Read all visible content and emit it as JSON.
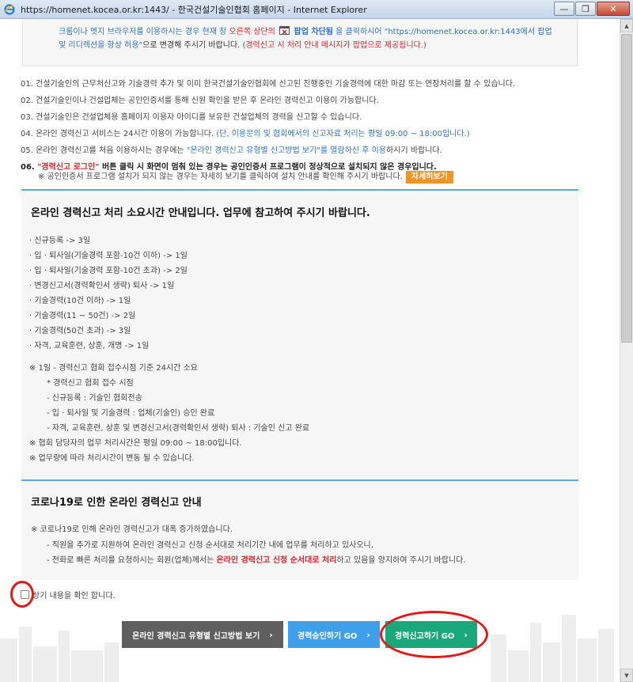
{
  "window": {
    "title": "https://homenet.kocea.or.kr:1443/ - 한국건설기술인협회 홈페이지 - Internet Explorer",
    "buttons": {
      "minimize": "—",
      "restore": "❐",
      "close": "✕"
    }
  },
  "notice": {
    "line1_a": "크롬이나 엣지 브라우저를 이용하시는 경우 현재 창 ",
    "line1_b": "오른쪽 상단의",
    "line1_c": " 팝업 차단됨",
    "line1_d": " 을 클릭하시어 \"https://homenet.kocea.or.kr:1443에서 팝업",
    "line2_a": "및 리디렉션을 항상 허용\"",
    "line2_b": "으로 변경해 주시기 바랍니다. ",
    "line2_c": "(경력신고 시 처리 안내 메시지가 팝업으로 제공됩니다.)"
  },
  "items": [
    "01. 건설기술인의 근무처신고와 기술경력 추가 및 이미 한국건설기술인협회에 신고된 진행중인 기술경력에 대한 마감 또는 연장처리를 할 수 있습니다.",
    "02. 건설기술인이나 건설업체는 공인인증서를 통해 신원 확인을 받은 후 온라인 경력신고 이용이 가능합니다.",
    "03. 건설기술인은 건설업체용 홈페이지 이용자 아이디를 보유한 건설업체의 경력을 신고할 수 있습니다."
  ],
  "item04": {
    "a": "04. 온라인 경력신고 서비스는 24시간 이용이 가능합니다. ",
    "b": "(단, 이용문의 및 협회에서의 신고자료 처리는 평일 09:00 ~ 18:00입니다.)"
  },
  "item05": {
    "a": "05. 온라인 경력신고를 처음 이용하시는 경우에는 ",
    "b": "\"온라인 경력신고 유형별 신고방법 보기\"를 열람하신 후 이용",
    "c": "하시기 바랍니다."
  },
  "item06": {
    "a": "06. ",
    "b": "\"경력신고 로그인\"",
    "c": " 버튼 클릭 시 화면이 멈춰 있는 경우는 공인인증서 프로그램이 정상적으로 설치되지 않은 경우입니다."
  },
  "subnote": {
    "text": "※ 공인인증서 프로그램 설치가 되지 않는 경우는 자세히 보기를 클릭하여 설치 안내를 확인해 주시기 바랍니다.",
    "button": "자세히보기"
  },
  "processing": {
    "title": "온라인 경력신고 처리 소요시간 안내입니다. 업무에 참고하여 주시기 바랍니다.",
    "times": [
      "· 신규등록 -> 3일",
      "· 입 · 퇴사일(기술경력 포함-10건 이하) -> 1일",
      "· 입 · 퇴사일(기술경력 포함-10건 초과) -> 2일",
      "· 변경신고서(경력확인서 생략) 퇴사 -> 1일",
      "· 기술경력(10건 이하) -> 1일",
      "· 기술경력(11 ~ 50건) -> 2일",
      "· 기술경력(50건 초과) -> 3일",
      "· 자격, 교육훈련, 상훈, 개명 -> 1일"
    ],
    "notes": [
      "※ 1일 - 경력신고 협회 접수시점 기준 24시간 소요",
      "* 경력신고 협회 접수 시점",
      "- 신규등록 : 기술인 협회전송",
      "- 입 · 퇴사일 및 기술경력 : 업체(기술인) 승인 완료",
      "- 자격, 교육훈련, 상훈 및 변경신고서(경력확인서 생략) 퇴사 : 기술인 신고 완료",
      "※ 협회 담당자의 업무 처리시간은 평일 09:00 ~ 18:00입니다.",
      "※ 업무량에 따라 처리시간이 변동 될 수 있습니다."
    ]
  },
  "corona": {
    "title": "코로나19로 인한 온라인 경력신고 안내",
    "line1": "※  코로나19로 인해 온라인 경력신고가 대폭 증가하였습니다.",
    "line2": "- 직원을 추가로 지원하여 온라인 경력신고 신청 순서대로 처리기간 내에 업무를 처리하고 있사오니,",
    "line3_a": "- 전화로 빠른 처리를 요청하시는 회원(업체)께서는 ",
    "line3_b": "온라인 경력신고 신청 순서대로 처리",
    "line3_c": "하고 있음을 양지하여 주시기 바랍니다."
  },
  "confirm": {
    "label": "상기 내용을 확인 합니다."
  },
  "buttons": {
    "guide": "온라인 경력신고 유형별 신고방법 보기",
    "approve": "경력승인하기 GO",
    "report": "경력신고하기 GO",
    "arrow": "›"
  },
  "colors": {
    "accent_blue": "#2f73c6",
    "alert_red": "#d8262c",
    "detail_orange": "#f29422",
    "btn_gray": "#5f5f5f",
    "btn_blue": "#3ea0ea",
    "btn_green": "#1aa77a",
    "annotation": "#e01919"
  }
}
